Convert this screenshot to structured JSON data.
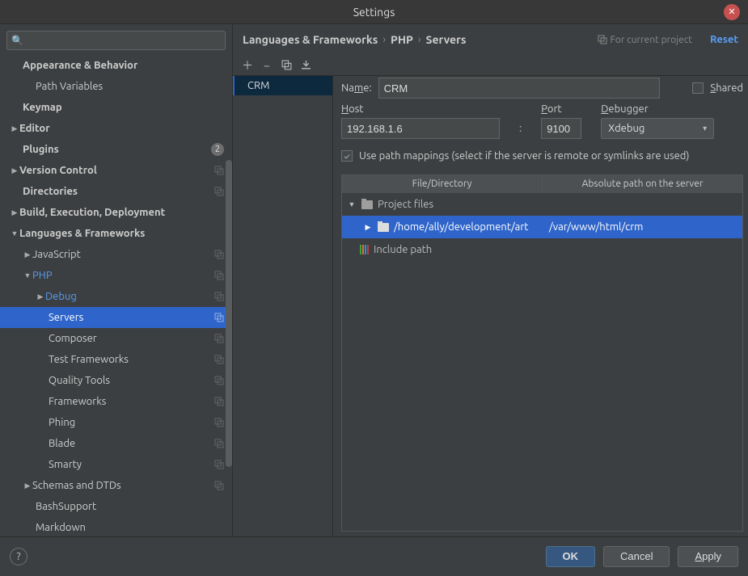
{
  "title": "Settings",
  "search_placeholder": "",
  "tree": {
    "appearance": "Appearance & Behavior",
    "path_vars": "Path Variables",
    "keymap": "Keymap",
    "editor": "Editor",
    "plugins": "Plugins",
    "plugins_badge": "2",
    "vcs": "Version Control",
    "directories": "Directories",
    "build": "Build, Execution, Deployment",
    "langs": "Languages & Frameworks",
    "javascript": "JavaScript",
    "php": "PHP",
    "debug": "Debug",
    "servers": "Servers",
    "composer": "Composer",
    "test_fw": "Test Frameworks",
    "quality": "Quality Tools",
    "frameworks": "Frameworks",
    "phing": "Phing",
    "blade": "Blade",
    "smarty": "Smarty",
    "schemas": "Schemas and DTDs",
    "bash": "BashSupport",
    "markdown": "Markdown"
  },
  "breadcrumb": {
    "a": "Languages & Frameworks",
    "b": "PHP",
    "c": "Servers"
  },
  "for_project": "For current project",
  "reset": "Reset",
  "server_list": {
    "item0": "CRM"
  },
  "form": {
    "name_label": "Name:",
    "name_value": "CRM",
    "shared_label": "Shared",
    "host_label": "Host",
    "port_label": "Port",
    "debugger_label": "Debugger",
    "host_value": "192.168.1.6",
    "colon": ":",
    "port_value": "9100",
    "debugger_value": "Xdebug",
    "use_path_label": "Use path mappings (select if the server is remote or symlinks are used)",
    "col_file": "File/Directory",
    "col_abs": "Absolute path on the server",
    "project_files": "Project files",
    "local_path": "/home/ally/development/art",
    "remote_path": "/var/www/html/crm",
    "include_path": "Include path"
  },
  "footer": {
    "ok": "OK",
    "cancel": "Cancel",
    "apply": "Apply"
  }
}
